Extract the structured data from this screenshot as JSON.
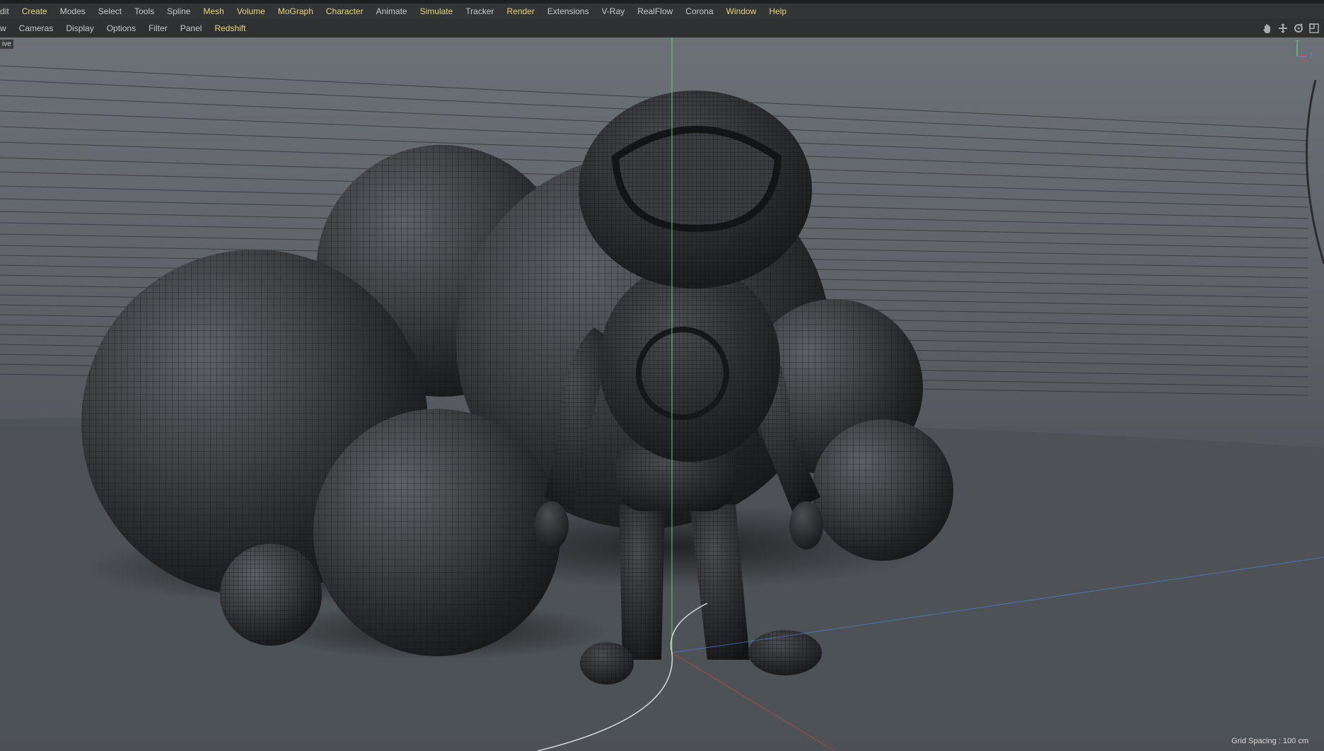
{
  "menubar": {
    "items": [
      {
        "label": "dit",
        "plugin": false
      },
      {
        "label": "Create",
        "plugin": true
      },
      {
        "label": "Modes",
        "plugin": false
      },
      {
        "label": "Select",
        "plugin": false
      },
      {
        "label": "Tools",
        "plugin": false
      },
      {
        "label": "Spline",
        "plugin": false
      },
      {
        "label": "Mesh",
        "plugin": true
      },
      {
        "label": "Volume",
        "plugin": true
      },
      {
        "label": "MoGraph",
        "plugin": true
      },
      {
        "label": "Character",
        "plugin": true
      },
      {
        "label": "Animate",
        "plugin": false
      },
      {
        "label": "Simulate",
        "plugin": true
      },
      {
        "label": "Tracker",
        "plugin": false
      },
      {
        "label": "Render",
        "plugin": true
      },
      {
        "label": "Extensions",
        "plugin": false
      },
      {
        "label": "V-Ray",
        "plugin": false
      },
      {
        "label": "RealFlow",
        "plugin": false
      },
      {
        "label": "Corona",
        "plugin": false
      },
      {
        "label": "Window",
        "plugin": true
      },
      {
        "label": "Help",
        "plugin": true
      }
    ]
  },
  "viewmenu": {
    "items": [
      {
        "label": "w",
        "plugin": false
      },
      {
        "label": "Cameras",
        "plugin": false
      },
      {
        "label": "Display",
        "plugin": false
      },
      {
        "label": "Options",
        "plugin": false
      },
      {
        "label": "Filter",
        "plugin": false
      },
      {
        "label": "Panel",
        "plugin": false
      },
      {
        "label": "Redshift",
        "plugin": true
      }
    ],
    "nav_icons": [
      "hand-icon",
      "move-icon",
      "rotate-icon",
      "maximize-icon"
    ]
  },
  "viewport": {
    "tag": "ive",
    "grid_spacing": "Grid Spacing : 100 cm",
    "axis": {
      "y": "Y",
      "x": "X",
      "z": "Z"
    }
  },
  "colors": {
    "accent_text": "#e6d77a",
    "menu_text": "#c8c8c8",
    "axis_x": "#e0453a",
    "axis_y": "#5fd07a",
    "axis_z": "#4a8be8"
  }
}
